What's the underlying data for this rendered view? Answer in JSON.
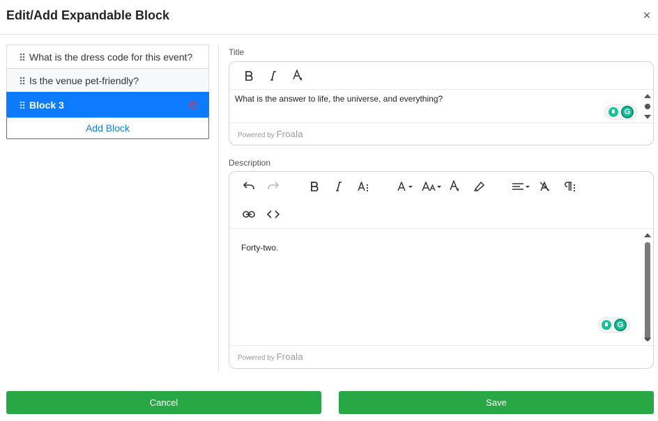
{
  "modal": {
    "title": "Edit/Add Expandable Block",
    "close_label": "×"
  },
  "blocks": [
    {
      "label": "What is the dress code for this event?"
    },
    {
      "label": "Is the venue pet-friendly?"
    },
    {
      "label": "Block 3"
    }
  ],
  "add_block_label": "Add Block",
  "title_field": {
    "label": "Title",
    "content": "What is the answer to life, the universe, and everything?"
  },
  "description_field": {
    "label": "Description",
    "content": "Forty-two."
  },
  "powered_by": {
    "prefix": "Powered by",
    "brand": "Froala"
  },
  "footer": {
    "cancel_label": "Cancel",
    "save_label": "Save"
  },
  "colors": {
    "primary": "#0d7bff",
    "success": "#28a745",
    "danger": "#dc3545"
  }
}
